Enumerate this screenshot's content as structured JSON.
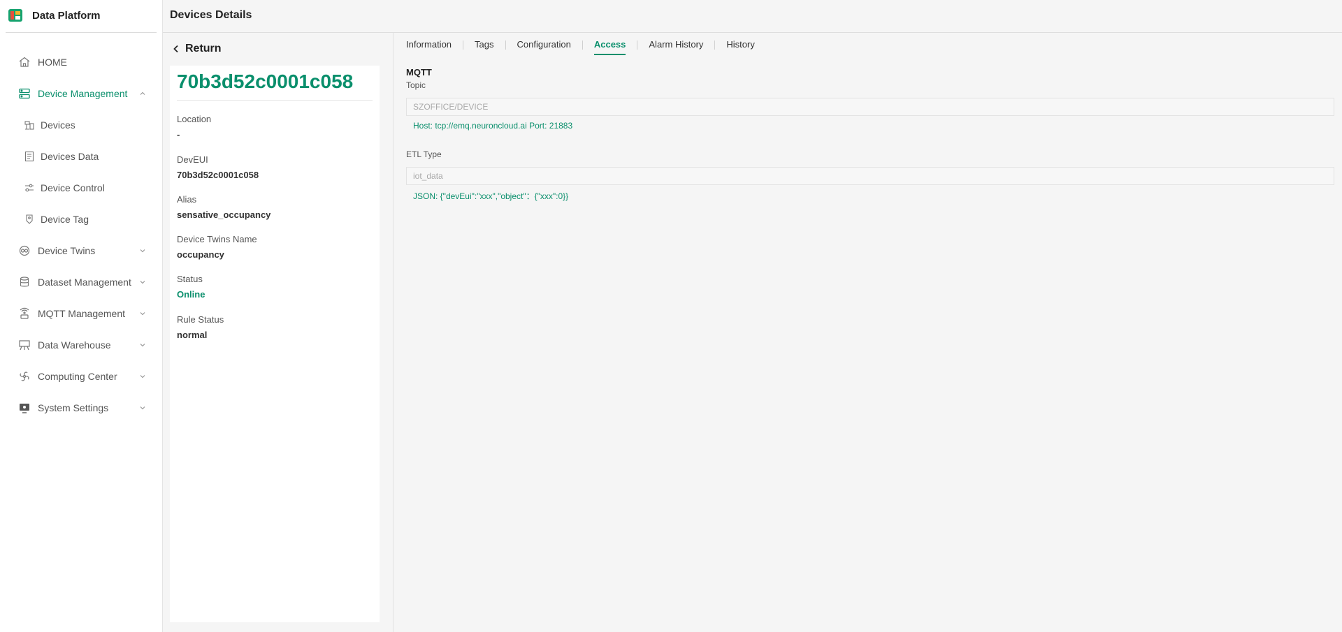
{
  "brand": {
    "name": "Data Platform"
  },
  "sidebar": {
    "items": [
      {
        "label": "HOME",
        "icon": "home-icon"
      },
      {
        "label": "Device Management",
        "icon": "server-icon",
        "expanded": true
      },
      {
        "label": "Devices",
        "icon": "devices-icon"
      },
      {
        "label": "Devices Data",
        "icon": "document-icon"
      },
      {
        "label": "Device Control",
        "icon": "sliders-icon"
      },
      {
        "label": "Device Tag",
        "icon": "tag-icon"
      },
      {
        "label": "Device Twins",
        "icon": "twins-icon"
      },
      {
        "label": "Dataset Management",
        "icon": "database-icon"
      },
      {
        "label": "MQTT Management",
        "icon": "signal-icon"
      },
      {
        "label": "Data Warehouse",
        "icon": "warehouse-icon"
      },
      {
        "label": "Computing Center",
        "icon": "fan-icon"
      },
      {
        "label": "System Settings",
        "icon": "monitor-icon"
      }
    ]
  },
  "header": {
    "title": "Devices Details"
  },
  "left_panel": {
    "return_label": "Return",
    "device_id": "70b3d52c0001c058",
    "fields": [
      {
        "label": "Location",
        "value": "-"
      },
      {
        "label": "DevEUI",
        "value": "70b3d52c0001c058"
      },
      {
        "label": "Alias",
        "value": "sensative_occupancy"
      },
      {
        "label": "Device Twins Name",
        "value": "occupancy"
      },
      {
        "label": "Status",
        "value": "Online"
      },
      {
        "label": "Rule Status",
        "value": "normal"
      }
    ]
  },
  "tabs": [
    "Information",
    "Tags",
    "Configuration",
    "Access",
    "Alarm History",
    "History"
  ],
  "active_tab": "Access",
  "access": {
    "mqtt_title": "MQTT",
    "topic_label": "Topic",
    "topic_value": "SZOFFICE/DEVICE",
    "host_hint": "Host: tcp://emq.neuroncloud.ai Port: 21883",
    "etl_label": "ETL Type",
    "etl_value": "iot_data",
    "json_hint": "JSON: {\"devEui\":\"xxx\",\"object\"：{\"xxx\":0}}"
  },
  "colors": {
    "accent": "#0a8f6c",
    "text": "#333333",
    "background": "#f5f5f5"
  }
}
